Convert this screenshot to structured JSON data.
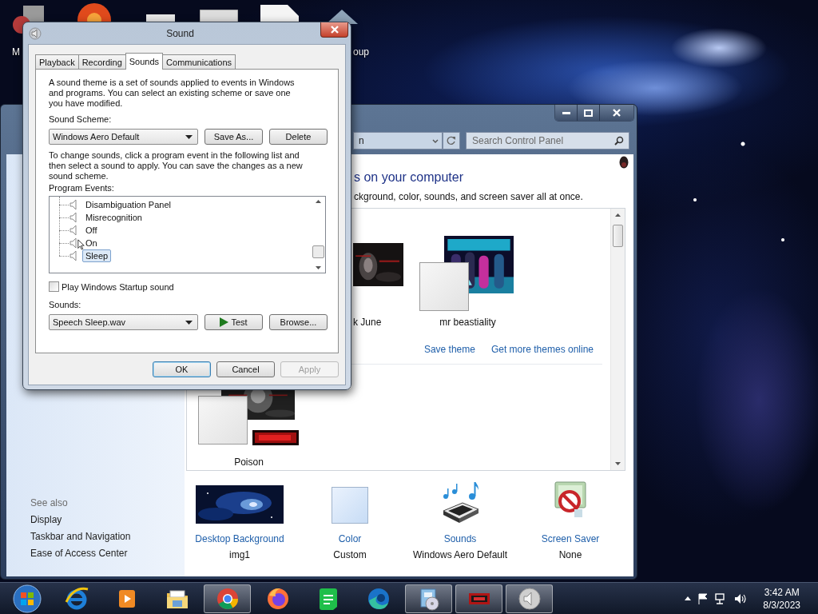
{
  "desktop_icons": [
    {
      "label": "M"
    },
    {
      "label": "oup"
    }
  ],
  "control_panel": {
    "address_text": "n",
    "search": {
      "placeholder": "Search Control Panel"
    },
    "heading": "s on your computer",
    "description": "ckground, color, sounds, and screen saver all at once.",
    "theme_groups": [
      {
        "themes": [
          {
            "name": "k June",
            "kind": "picture"
          },
          {
            "name": "mr beastiality",
            "kind": "picture"
          }
        ],
        "links": [
          "Save theme",
          "Get more themes online"
        ]
      },
      {
        "themes": [
          {
            "name": "Poison",
            "kind": "picture"
          }
        ]
      }
    ],
    "see_also": {
      "title": "See also",
      "links": [
        "Display",
        "Taskbar and Navigation",
        "Ease of Access Center"
      ]
    },
    "settings": [
      {
        "kind": "wallpaper",
        "title": "Desktop Background",
        "value": "img1"
      },
      {
        "kind": "color",
        "title": "Color",
        "value": "Custom"
      },
      {
        "kind": "sounds",
        "title": "Sounds",
        "value": "Windows Aero Default"
      },
      {
        "kind": "screensaver",
        "title": "Screen Saver",
        "value": "None"
      }
    ]
  },
  "sound_dialog": {
    "title": "Sound",
    "tabs": [
      {
        "label": "Playback",
        "selected": false
      },
      {
        "label": "Recording",
        "selected": false
      },
      {
        "label": "Sounds",
        "selected": true
      },
      {
        "label": "Communications",
        "selected": false
      }
    ],
    "intro": "A sound theme is a set of sounds applied to events in Windows and programs.  You can select an existing scheme or save one you have modified.",
    "scheme_label": "Sound Scheme:",
    "scheme_value": "Windows Aero Default",
    "scheme_buttons": [
      "Save As...",
      "Delete"
    ],
    "events_intro": "To change sounds, click a program event in the following list and then select a sound to apply.  You can save the changes as a new sound scheme.",
    "events_label": "Program Events:",
    "events": [
      {
        "label": "Disambiguation Panel",
        "selected": false
      },
      {
        "label": "Misrecognition",
        "selected": false
      },
      {
        "label": "Off",
        "selected": false
      },
      {
        "label": "On",
        "selected": false
      },
      {
        "label": "Sleep",
        "selected": true
      }
    ],
    "startup": {
      "label": "Play Windows Startup sound",
      "checked": false
    },
    "sounds_label": "Sounds:",
    "sound_value": "Speech Sleep.wav",
    "test_button": "Test",
    "browse_button": "Browse...",
    "footer_buttons": [
      {
        "label": "OK",
        "default": true,
        "disabled": false
      },
      {
        "label": "Cancel",
        "default": false,
        "disabled": false
      },
      {
        "label": "Apply",
        "default": false,
        "disabled": true
      }
    ]
  },
  "taskbar": {
    "apps": [
      {
        "kind": "ie",
        "open": false
      },
      {
        "kind": "media",
        "open": false
      },
      {
        "kind": "explorer",
        "open": false
      },
      {
        "kind": "chrome",
        "open": true
      },
      {
        "kind": "firefox",
        "open": false
      },
      {
        "kind": "notes",
        "open": false
      },
      {
        "kind": "edge",
        "open": false
      },
      {
        "kind": "installer",
        "open": true
      },
      {
        "kind": "game",
        "open": true
      },
      {
        "kind": "speaker",
        "open": true
      }
    ],
    "time": "3:42 AM",
    "date": "8/3/2023"
  }
}
